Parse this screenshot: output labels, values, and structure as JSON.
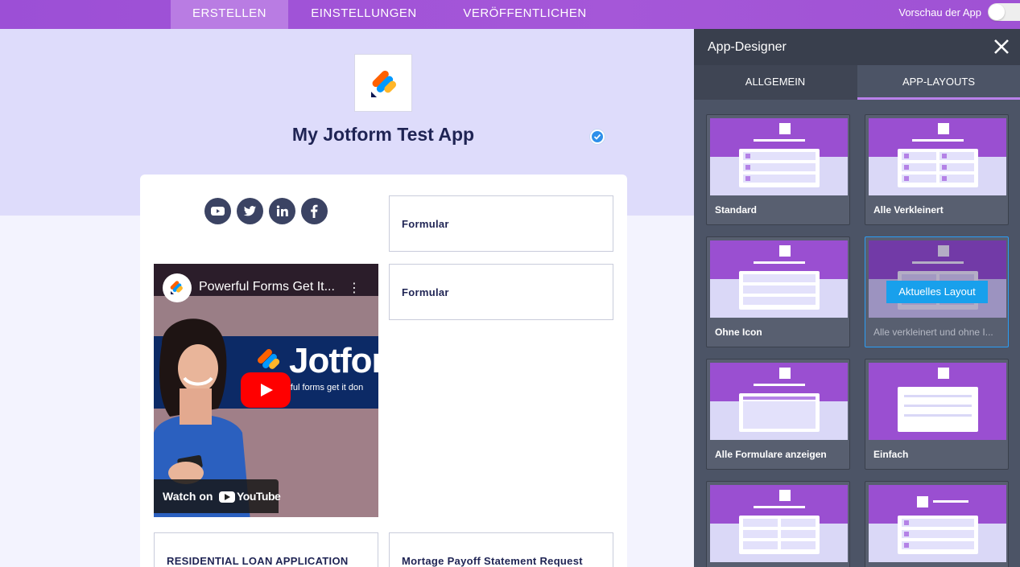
{
  "topbar": {
    "tabs": [
      {
        "label": "ERSTELLEN",
        "active": true
      },
      {
        "label": "EINSTELLUNGEN",
        "active": false
      },
      {
        "label": "VERÖFFENTLICHEN",
        "active": false
      }
    ],
    "preview_label": "Vorschau der App"
  },
  "app": {
    "title": "My Jotform Test App",
    "social_icons": [
      "youtube-icon",
      "twitter-icon",
      "linkedin-icon",
      "facebook-icon"
    ],
    "forms": [
      {
        "label": "Formular"
      },
      {
        "label": "Formular"
      },
      {
        "label": "RESIDENTIAL LOAN APPLICATION"
      },
      {
        "label": "Mortage Payoff Statement Request"
      }
    ],
    "video": {
      "title": "Powerful Forms Get It...",
      "brand": "Jotform",
      "tagline": "erful forms get it don",
      "watch_on": "Watch on",
      "youtube": "YouTube"
    }
  },
  "panel": {
    "title": "App-Designer",
    "tabs": [
      {
        "label": "ALLGEMEIN",
        "active": false
      },
      {
        "label": "APP-LAYOUTS",
        "active": true
      }
    ],
    "layouts": [
      {
        "label": "Standard"
      },
      {
        "label": "Alle Verkleinert"
      },
      {
        "label": "Ohne Icon"
      },
      {
        "label": "Alle verkleinert und ohne I...",
        "current": true
      },
      {
        "label": "Alle Formulare anzeigen"
      },
      {
        "label": "Einfach"
      },
      {
        "label": ""
      },
      {
        "label": ""
      }
    ],
    "current_badge": "Aktuelles Layout"
  },
  "colors": {
    "topbar": "#a557d8",
    "accent": "#9a4fd1",
    "panel": "#4c5466",
    "badge": "#18a0ec",
    "title": "#1f2454"
  }
}
